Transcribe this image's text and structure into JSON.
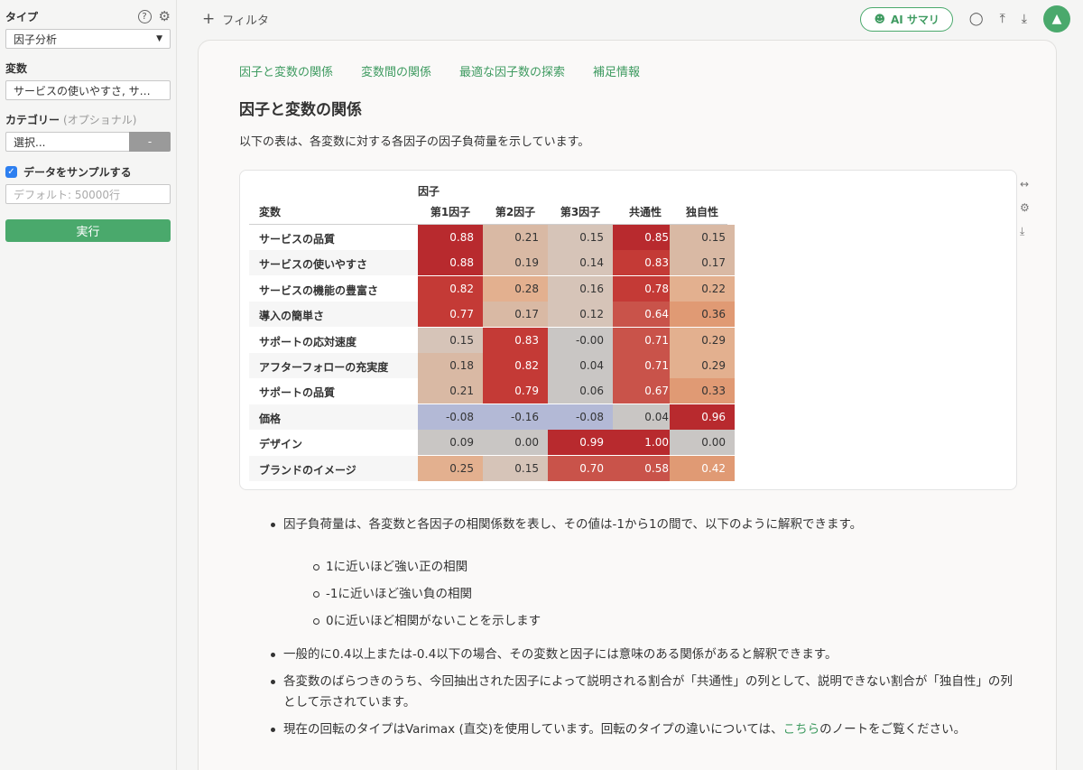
{
  "sidebar": {
    "type_label": "タイプ",
    "type_value": "因子分析",
    "vars_label": "変数",
    "vars_value": "サービスの使いやすさ, サ…",
    "category_label": "カテゴリー",
    "category_optional": "(オプショナル)",
    "category_placeholder": "選択...",
    "category_button": "-",
    "sample_label": "データをサンプルする",
    "sample_checked": true,
    "sample_placeholder": "デフォルト: 50000行",
    "run_label": "実行"
  },
  "topbar": {
    "filter_label": "フィルタ",
    "ai_label": "AI サマリ"
  },
  "tabs": [
    "因子と変数の関係",
    "変数間の関係",
    "最適な因子数の探索",
    "補足情報"
  ],
  "section": {
    "title": "因子と変数の関係",
    "description": "以下の表は、各変数に対する各因子の因子負荷量を示しています。"
  },
  "table": {
    "group_header": "因子",
    "var_header": "変数",
    "columns": [
      "第1因子",
      "第2因子",
      "第3因子",
      "共通性",
      "独自性"
    ],
    "rows": [
      {
        "label": "サービスの品質",
        "values": [
          "0.88",
          "0.21",
          "0.15",
          "0.85",
          "0.15"
        ]
      },
      {
        "label": "サービスの使いやすさ",
        "values": [
          "0.88",
          "0.19",
          "0.14",
          "0.83",
          "0.17"
        ]
      },
      {
        "label": "サービスの機能の豊富さ",
        "values": [
          "0.82",
          "0.28",
          "0.16",
          "0.78",
          "0.22"
        ]
      },
      {
        "label": "導入の簡単さ",
        "values": [
          "0.77",
          "0.17",
          "0.12",
          "0.64",
          "0.36"
        ]
      },
      {
        "label": "サポートの応対速度",
        "values": [
          "0.15",
          "0.83",
          "-0.00",
          "0.71",
          "0.29"
        ]
      },
      {
        "label": "アフターフォローの充実度",
        "values": [
          "0.18",
          "0.82",
          "0.04",
          "0.71",
          "0.29"
        ]
      },
      {
        "label": "サポートの品質",
        "values": [
          "0.21",
          "0.79",
          "0.06",
          "0.67",
          "0.33"
        ]
      },
      {
        "label": "価格",
        "values": [
          "-0.08",
          "-0.16",
          "-0.08",
          "0.04",
          "0.96"
        ]
      },
      {
        "label": "デザイン",
        "values": [
          "0.09",
          "0.00",
          "0.99",
          "1.00",
          "0.00"
        ]
      },
      {
        "label": "ブランドのイメージ",
        "values": [
          "0.25",
          "0.15",
          "0.70",
          "0.58",
          "0.42"
        ]
      }
    ],
    "colors": {
      "strong": "#b82a2e",
      "strong2": "#c43a36",
      "medium": "#c9534a",
      "orange": "#e09a74",
      "light_orange": "#e3b08f",
      "tan": "#d9b9a4",
      "beige": "#d6c4b8",
      "gray": "#c9c6c4",
      "blue": "#b3b9d6"
    }
  },
  "bullets": {
    "b1": "因子負荷量は、各変数と各因子の相関係数を表し、その値は-1から1の間で、以下のように解釈できます。",
    "s1": "1に近いほど強い正の相関",
    "s2": "-1に近いほど強い負の相関",
    "s3": "0に近いほど相関がないことを示します",
    "b2": "一般的に0.4以上または-0.4以下の場合、その変数と因子には意味のある関係があると解釈できます。",
    "b3": "各変数のばらつきのうち、今回抽出された因子によって説明される割合が「共通性」の列として、説明できない割合が「独自性」の列として示されています。",
    "b4_pre": "現在の回転のタイプはVarimax (直交)を使用しています。回転のタイプの違いについては、",
    "b4_link": "こちら",
    "b4_post": "のノートをご覧ください。"
  }
}
